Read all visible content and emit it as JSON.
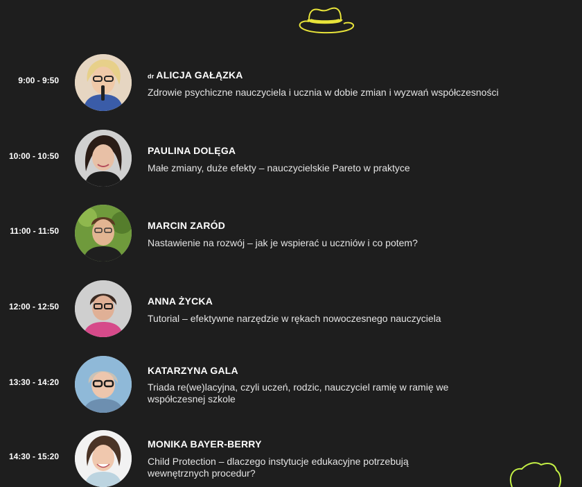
{
  "colors": {
    "background": "#1e1e1e",
    "accent": "#e8e43a",
    "accent_green": "#c4f046"
  },
  "icons": {
    "header": "hat-icon",
    "footer": "decorative-shape-icon"
  },
  "sessions": [
    {
      "time": "9:00 - 9:50",
      "prefix": "dr",
      "speaker": "ALICJA GAŁĄZKA",
      "topic": "Zdrowie psychiczne nauczyciela i ucznia w dobie zmian i wyzwań współczesności"
    },
    {
      "time": "10:00 - 10:50",
      "prefix": "",
      "speaker": "PAULINA DOLĘGA",
      "topic": "Małe zmiany, duże efekty – nauczycielskie Pareto w praktyce"
    },
    {
      "time": "11:00 - 11:50",
      "prefix": "",
      "speaker": "MARCIN ZARÓD",
      "topic": "Nastawienie na rozwój – jak je wspierać u uczniów i co potem?"
    },
    {
      "time": "12:00 - 12:50",
      "prefix": "",
      "speaker": "ANNA ŻYCKA",
      "topic": "Tutorial – efektywne narzędzie w rękach nowoczesnego nauczyciela"
    },
    {
      "time": "13:30 - 14:20",
      "prefix": "",
      "speaker": "KATARZYNA GALA",
      "topic": "Triada re(we)lacyjna, czyli uczeń, rodzic, nauczyciel ramię w ramię we współczesnej szkole"
    },
    {
      "time": "14:30 - 15:20",
      "prefix": "",
      "speaker": "MONIKA BAYER-BERRY",
      "topic": "Child Protection – dlaczego instytucje edukacyjne potrzebują wewnętrznych procedur?"
    }
  ]
}
